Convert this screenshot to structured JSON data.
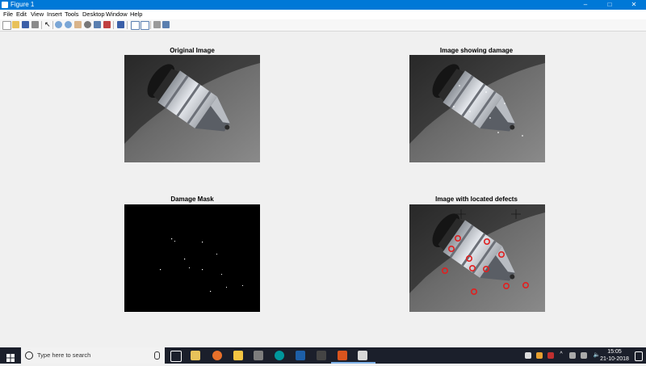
{
  "window": {
    "title": "Figure 1"
  },
  "menu": [
    "File",
    "Edit",
    "View",
    "Insert",
    "Tools",
    "Desktop",
    "Window",
    "Help"
  ],
  "toolbar": {
    "icons": [
      "new-figure-icon",
      "open-file-icon",
      "save-icon",
      "print-icon",
      "pointer-icon",
      "zoom-in-icon",
      "zoom-out-icon",
      "pan-icon",
      "rotate-icon",
      "data-cursor-icon",
      "brush-icon",
      "link-icon",
      "insert-colorbar-icon",
      "insert-legend-icon",
      "hide-plot-tools-icon",
      "show-plot-tools-icon"
    ]
  },
  "panels": {
    "original": {
      "title": "Original Image"
    },
    "damage": {
      "title": "Image showing damage"
    },
    "mask": {
      "title": "Damage Mask"
    },
    "located": {
      "title": "Image with located defects"
    }
  },
  "taskbar": {
    "search_placeholder": "Type here to search",
    "time": "15:05",
    "date": "21-10-2018"
  },
  "colors": {
    "titlebar": "#0078d7",
    "taskbar": "#1b1f2b",
    "defect_marker": "#e02020"
  }
}
